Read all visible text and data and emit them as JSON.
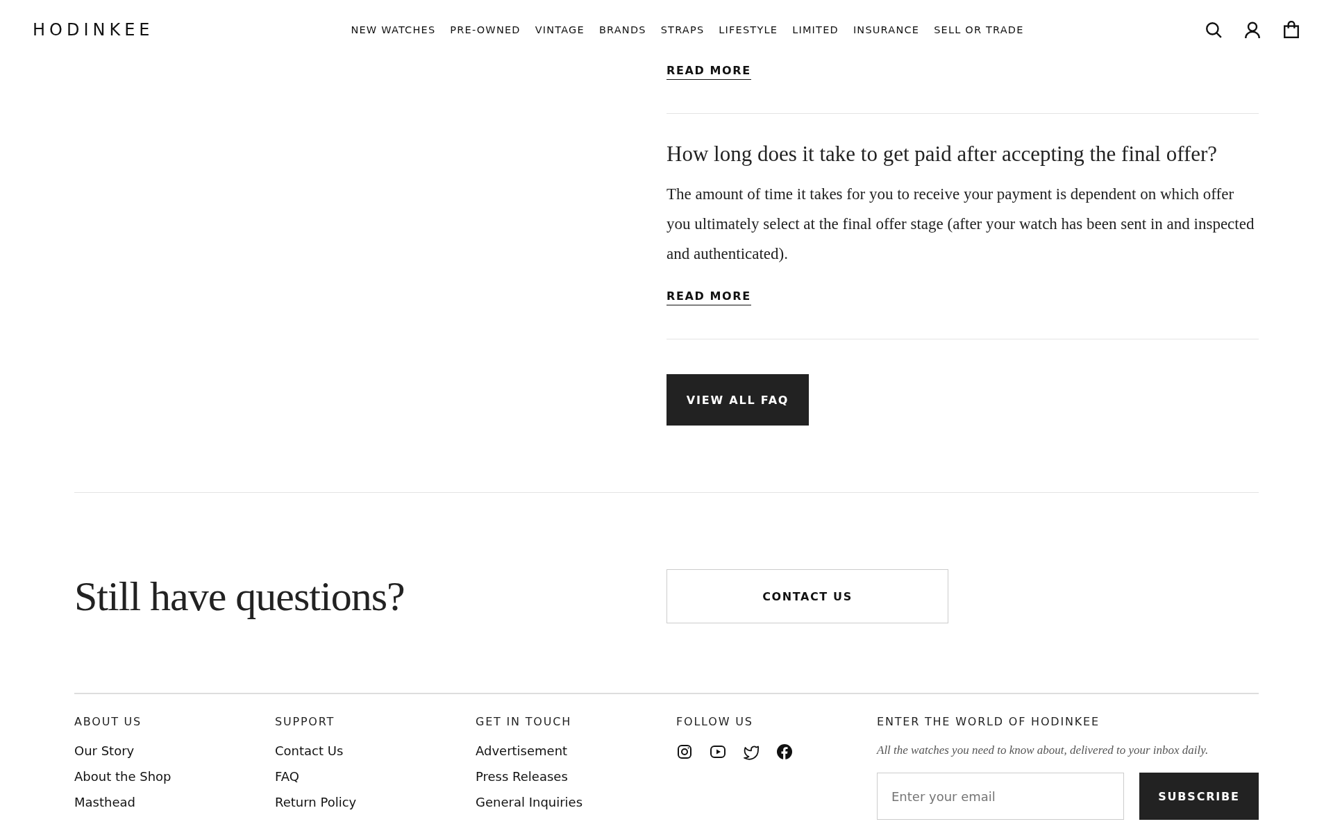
{
  "header": {
    "logo": "HODINKEE",
    "nav": [
      "NEW WATCHES",
      "PRE-OWNED",
      "VINTAGE",
      "BRANDS",
      "STRAPS",
      "LIFESTYLE",
      "LIMITED",
      "INSURANCE",
      "SELL OR TRADE"
    ]
  },
  "faq": {
    "items": [
      {
        "link": "READ MORE"
      },
      {
        "question": "How long does it take to get paid after accepting the final offer?",
        "answer": "The amount of time it takes for you to receive your payment is dependent on which offer you ultimately select at the final offer stage (after your watch has been sent in and inspected and authenticated).",
        "link": "READ MORE"
      }
    ],
    "button": "VIEW ALL FAQ"
  },
  "cta": {
    "heading": "Still have questions?",
    "button": "CONTACT US"
  },
  "footer": {
    "columns": [
      {
        "kind": "links",
        "heading": "ABOUT US",
        "links": [
          "Our Story",
          "About the Shop",
          "Masthead"
        ]
      },
      {
        "kind": "links",
        "heading": "SUPPORT",
        "links": [
          "Contact Us",
          "FAQ",
          "Return Policy"
        ]
      },
      {
        "kind": "links",
        "heading": "GET IN TOUCH",
        "links": [
          "Advertisement",
          "Press Releases",
          "General Inquiries"
        ]
      },
      {
        "kind": "social",
        "heading": "FOLLOW US"
      }
    ],
    "newsletter": {
      "heading": "ENTER THE WORLD OF HODINKEE",
      "tagline": "All the watches you need to know about, delivered to your inbox daily.",
      "placeholder": "Enter your email",
      "button": "SUBSCRIBE"
    }
  }
}
